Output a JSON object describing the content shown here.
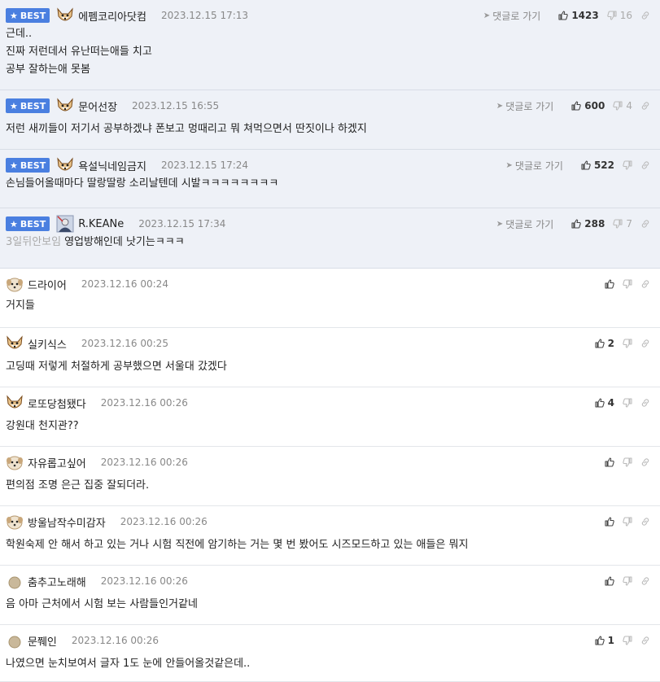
{
  "best_label": "BEST",
  "reply_link_label": "댓글로 가기",
  "colors": {
    "best_bg": "#eef1f7",
    "badge": "#4a7fe0"
  },
  "comments": [
    {
      "nick": "에펨코리아닷컴",
      "date": "2023.12.15 17:13",
      "best": true,
      "avatar": "fox-avatar-icon",
      "up": "1423",
      "down": "16",
      "text": "근데..\n진짜 저런데서 유난떠는애들 치고\n공부 잘하는애 못봄"
    },
    {
      "nick": "문어선장",
      "date": "2023.12.15 16:55",
      "best": true,
      "avatar": "fox-avatar-icon",
      "up": "600",
      "down": "4",
      "text": "저런 새끼들이 저기서 공부하겠냐 폰보고 멍때리고 뭐 쳐먹으면서 딴짓이나 하겠지"
    },
    {
      "nick": "욕설닉네임금지",
      "date": "2023.12.15 17:24",
      "best": true,
      "avatar": "fox-avatar-icon",
      "up": "522",
      "down": "",
      "text": "손님들어올때마다 딸랑딸랑 소리날텐데 시발ㅋㅋㅋㅋㅋㅋㅋㅋ"
    },
    {
      "nick": "R.KEANe",
      "date": "2023.12.15 17:34",
      "best": true,
      "avatar": "photo-avatar-icon",
      "up": "288",
      "down": "7",
      "prefix": "3일뒤안보임",
      "text": "영업방해인데 낫기는ㅋㅋㅋ"
    },
    {
      "nick": "드라이어",
      "date": "2023.12.16 00:24",
      "best": false,
      "avatar": "puppy-avatar-icon",
      "up": "",
      "down": "",
      "text": "거지들"
    },
    {
      "nick": "실키식스",
      "date": "2023.12.16 00:25",
      "best": false,
      "avatar": "fox-avatar-icon",
      "up": "2",
      "down": "",
      "text": "고딩때 저렇게 처절하게 공부했으면 서울대 갔겠다"
    },
    {
      "nick": "로또당첨됐다",
      "date": "2023.12.16 00:26",
      "best": false,
      "avatar": "fox-avatar-icon",
      "up": "4",
      "down": "",
      "text": "강원대 천지관??"
    },
    {
      "nick": "자유롭고싶어",
      "date": "2023.12.16 00:26",
      "best": false,
      "avatar": "puppy-avatar-icon",
      "up": "",
      "down": "",
      "text": "편의점 조명 은근 집중 잘되더라."
    },
    {
      "nick": "방울남작수미감자",
      "date": "2023.12.16 00:26",
      "best": false,
      "avatar": "puppy-avatar-icon",
      "up": "",
      "down": "",
      "text": "학원숙제 안 해서 하고 있는 거나 시험 직전에 암기하는 거는 몇 번 봤어도 시즈모드하고 있는 애들은 뭐지"
    },
    {
      "nick": "춤추고노래해",
      "date": "2023.12.16 00:26",
      "best": false,
      "avatar": "egg-avatar-icon",
      "up": "",
      "down": "",
      "text": "음 아마 근처에서 시험 보는 사람들인거같네"
    },
    {
      "nick": "문쮀인",
      "date": "2023.12.16 00:26",
      "best": false,
      "avatar": "egg-avatar-icon",
      "up": "1",
      "down": "",
      "text": "나였으면 눈치보여서 글자 1도 눈에 안들어올것같은데.."
    }
  ]
}
